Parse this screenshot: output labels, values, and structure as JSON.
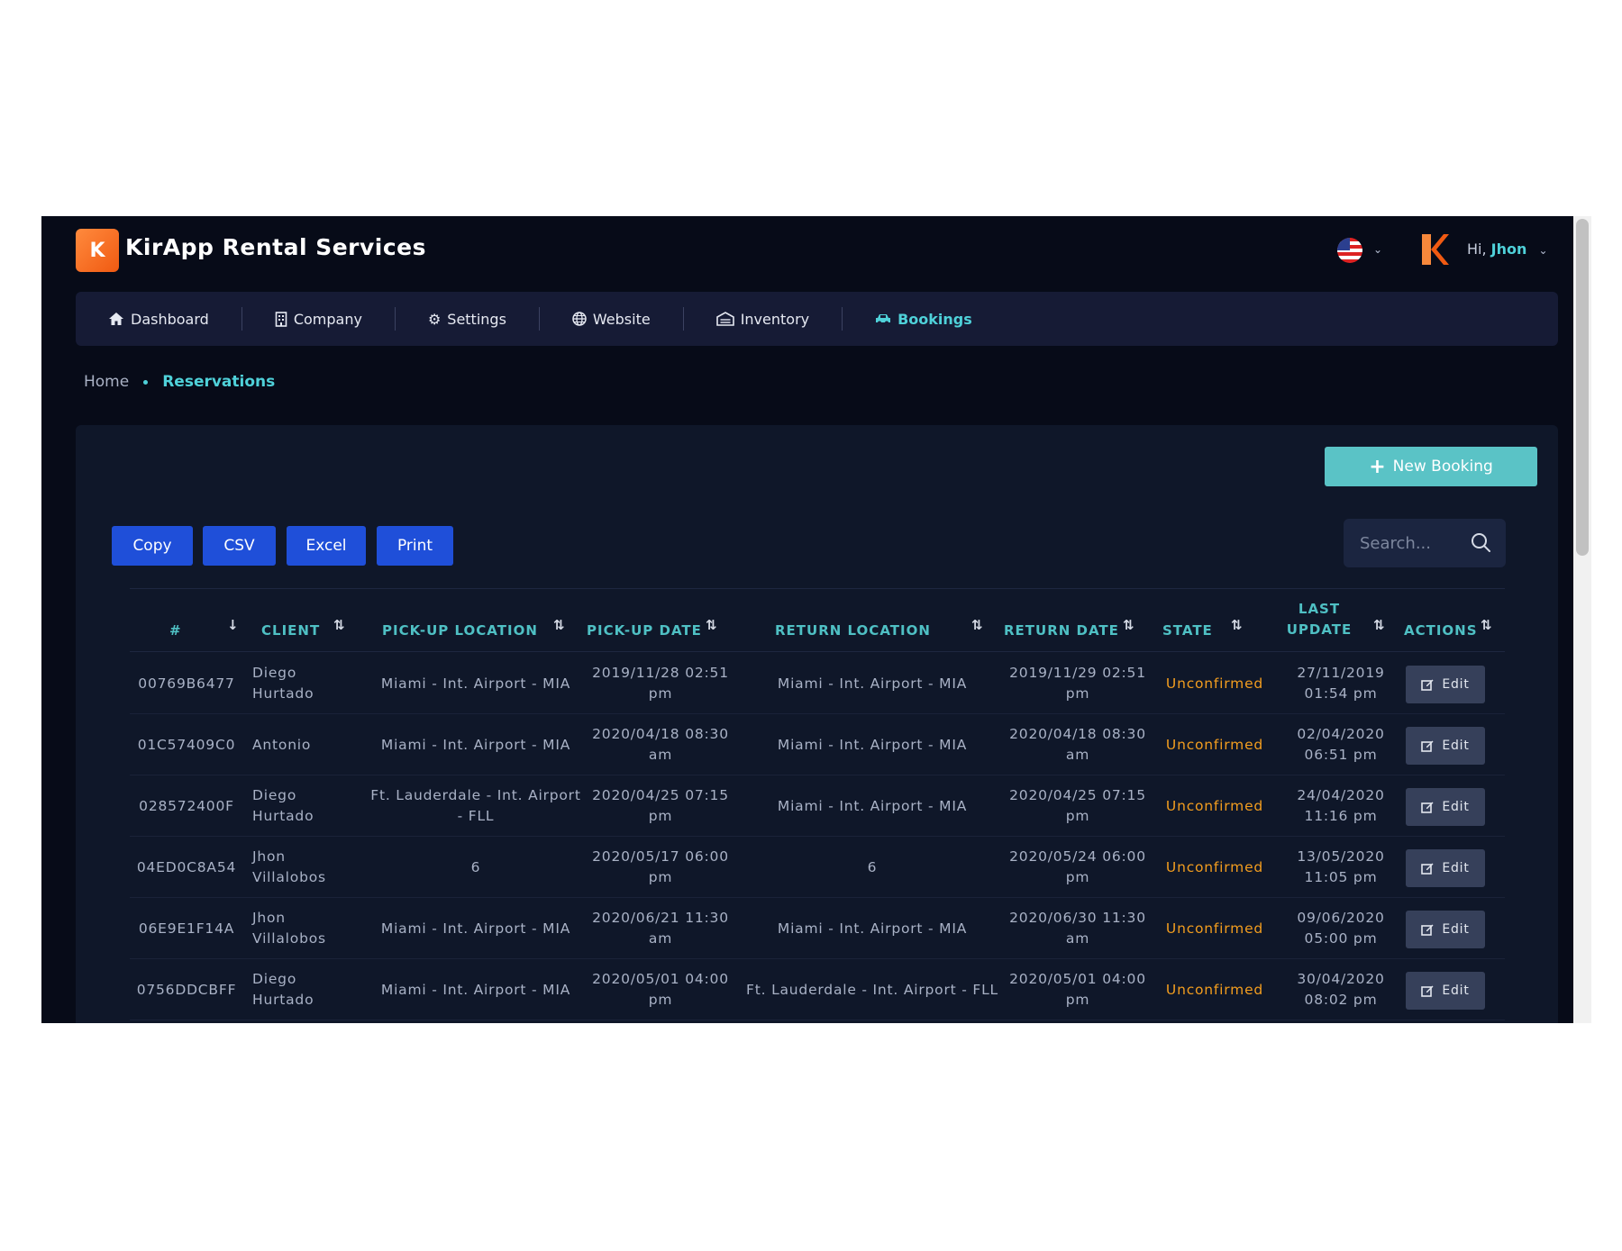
{
  "app": {
    "brand": "KirApp Rental Services",
    "logo_letter": "K",
    "greeting_prefix": "Hi,",
    "user_name": "Jhon"
  },
  "nav": [
    {
      "label": "Dashboard",
      "icon": "home-icon",
      "active": false
    },
    {
      "label": "Company",
      "icon": "building-icon",
      "active": false
    },
    {
      "label": "Settings",
      "icon": "gears-icon",
      "active": false
    },
    {
      "label": "Website",
      "icon": "globe-icon",
      "active": false
    },
    {
      "label": "Inventory",
      "icon": "warehouse-icon",
      "active": false
    },
    {
      "label": "Bookings",
      "icon": "car-icon",
      "active": true
    }
  ],
  "breadcrumb": {
    "home": "Home",
    "current": "Reservations"
  },
  "actions": {
    "new_booking": "New Booking",
    "copy": "Copy",
    "csv": "CSV",
    "excel": "Excel",
    "print": "Print",
    "search_placeholder": "Search..."
  },
  "table": {
    "headers": [
      "#",
      "CLIENT",
      "PICK-UP LOCATION",
      "PICK-UP DATE",
      "RETURN LOCATION",
      "RETURN DATE",
      "STATE",
      "LAST UPDATE",
      "ACTIONS"
    ],
    "rows": [
      {
        "id": "00769B6477",
        "client": "Diego Hurtado",
        "pickup_location": "Miami - Int. Airport - MIA",
        "pickup_date": "2019/11/28 02:51 pm",
        "return_location": "Miami - Int. Airport - MIA",
        "return_date": "2019/11/29 02:51 pm",
        "state": "Unconfirmed",
        "last_update": "27/11/2019 01:54 pm",
        "action": "Edit"
      },
      {
        "id": "01C57409C0",
        "client": "Antonio",
        "pickup_location": "Miami - Int. Airport - MIA",
        "pickup_date": "2020/04/18 08:30 am",
        "return_location": "Miami - Int. Airport - MIA",
        "return_date": "2020/04/18 08:30 am",
        "state": "Unconfirmed",
        "last_update": "02/04/2020 06:51 pm",
        "action": "Edit"
      },
      {
        "id": "028572400F",
        "client": "Diego Hurtado",
        "pickup_location": "Ft. Lauderdale - Int. Airport - FLL",
        "pickup_date": "2020/04/25 07:15 pm",
        "return_location": "Miami - Int. Airport - MIA",
        "return_date": "2020/04/25 07:15 pm",
        "state": "Unconfirmed",
        "last_update": "24/04/2020 11:16 pm",
        "action": "Edit"
      },
      {
        "id": "04ED0C8A54",
        "client": "Jhon Villalobos",
        "pickup_location": "6",
        "pickup_date": "2020/05/17 06:00 pm",
        "return_location": "6",
        "return_date": "2020/05/24 06:00 pm",
        "state": "Unconfirmed",
        "last_update": "13/05/2020 11:05 pm",
        "action": "Edit"
      },
      {
        "id": "06E9E1F14A",
        "client": "Jhon Villalobos",
        "pickup_location": "Miami - Int. Airport - MIA",
        "pickup_date": "2020/06/21 11:30 am",
        "return_location": "Miami - Int. Airport - MIA",
        "return_date": "2020/06/30 11:30 am",
        "state": "Unconfirmed",
        "last_update": "09/06/2020 05:00 pm",
        "action": "Edit"
      },
      {
        "id": "0756DDCBFF",
        "client": "Diego Hurtado",
        "pickup_location": "Miami - Int. Airport - MIA",
        "pickup_date": "2020/05/01 04:00 pm",
        "return_location": "Ft. Lauderdale - Int. Airport - FLL",
        "return_date": "2020/05/01 04:00 pm",
        "state": "Unconfirmed",
        "last_update": "30/04/2020 08:02 pm",
        "action": "Edit"
      }
    ]
  },
  "colors": {
    "accent": "#4fd1d9",
    "state_unconfirmed": "#f29d1f",
    "export_button": "#1f4fd9",
    "new_button": "#5ac3c6"
  }
}
